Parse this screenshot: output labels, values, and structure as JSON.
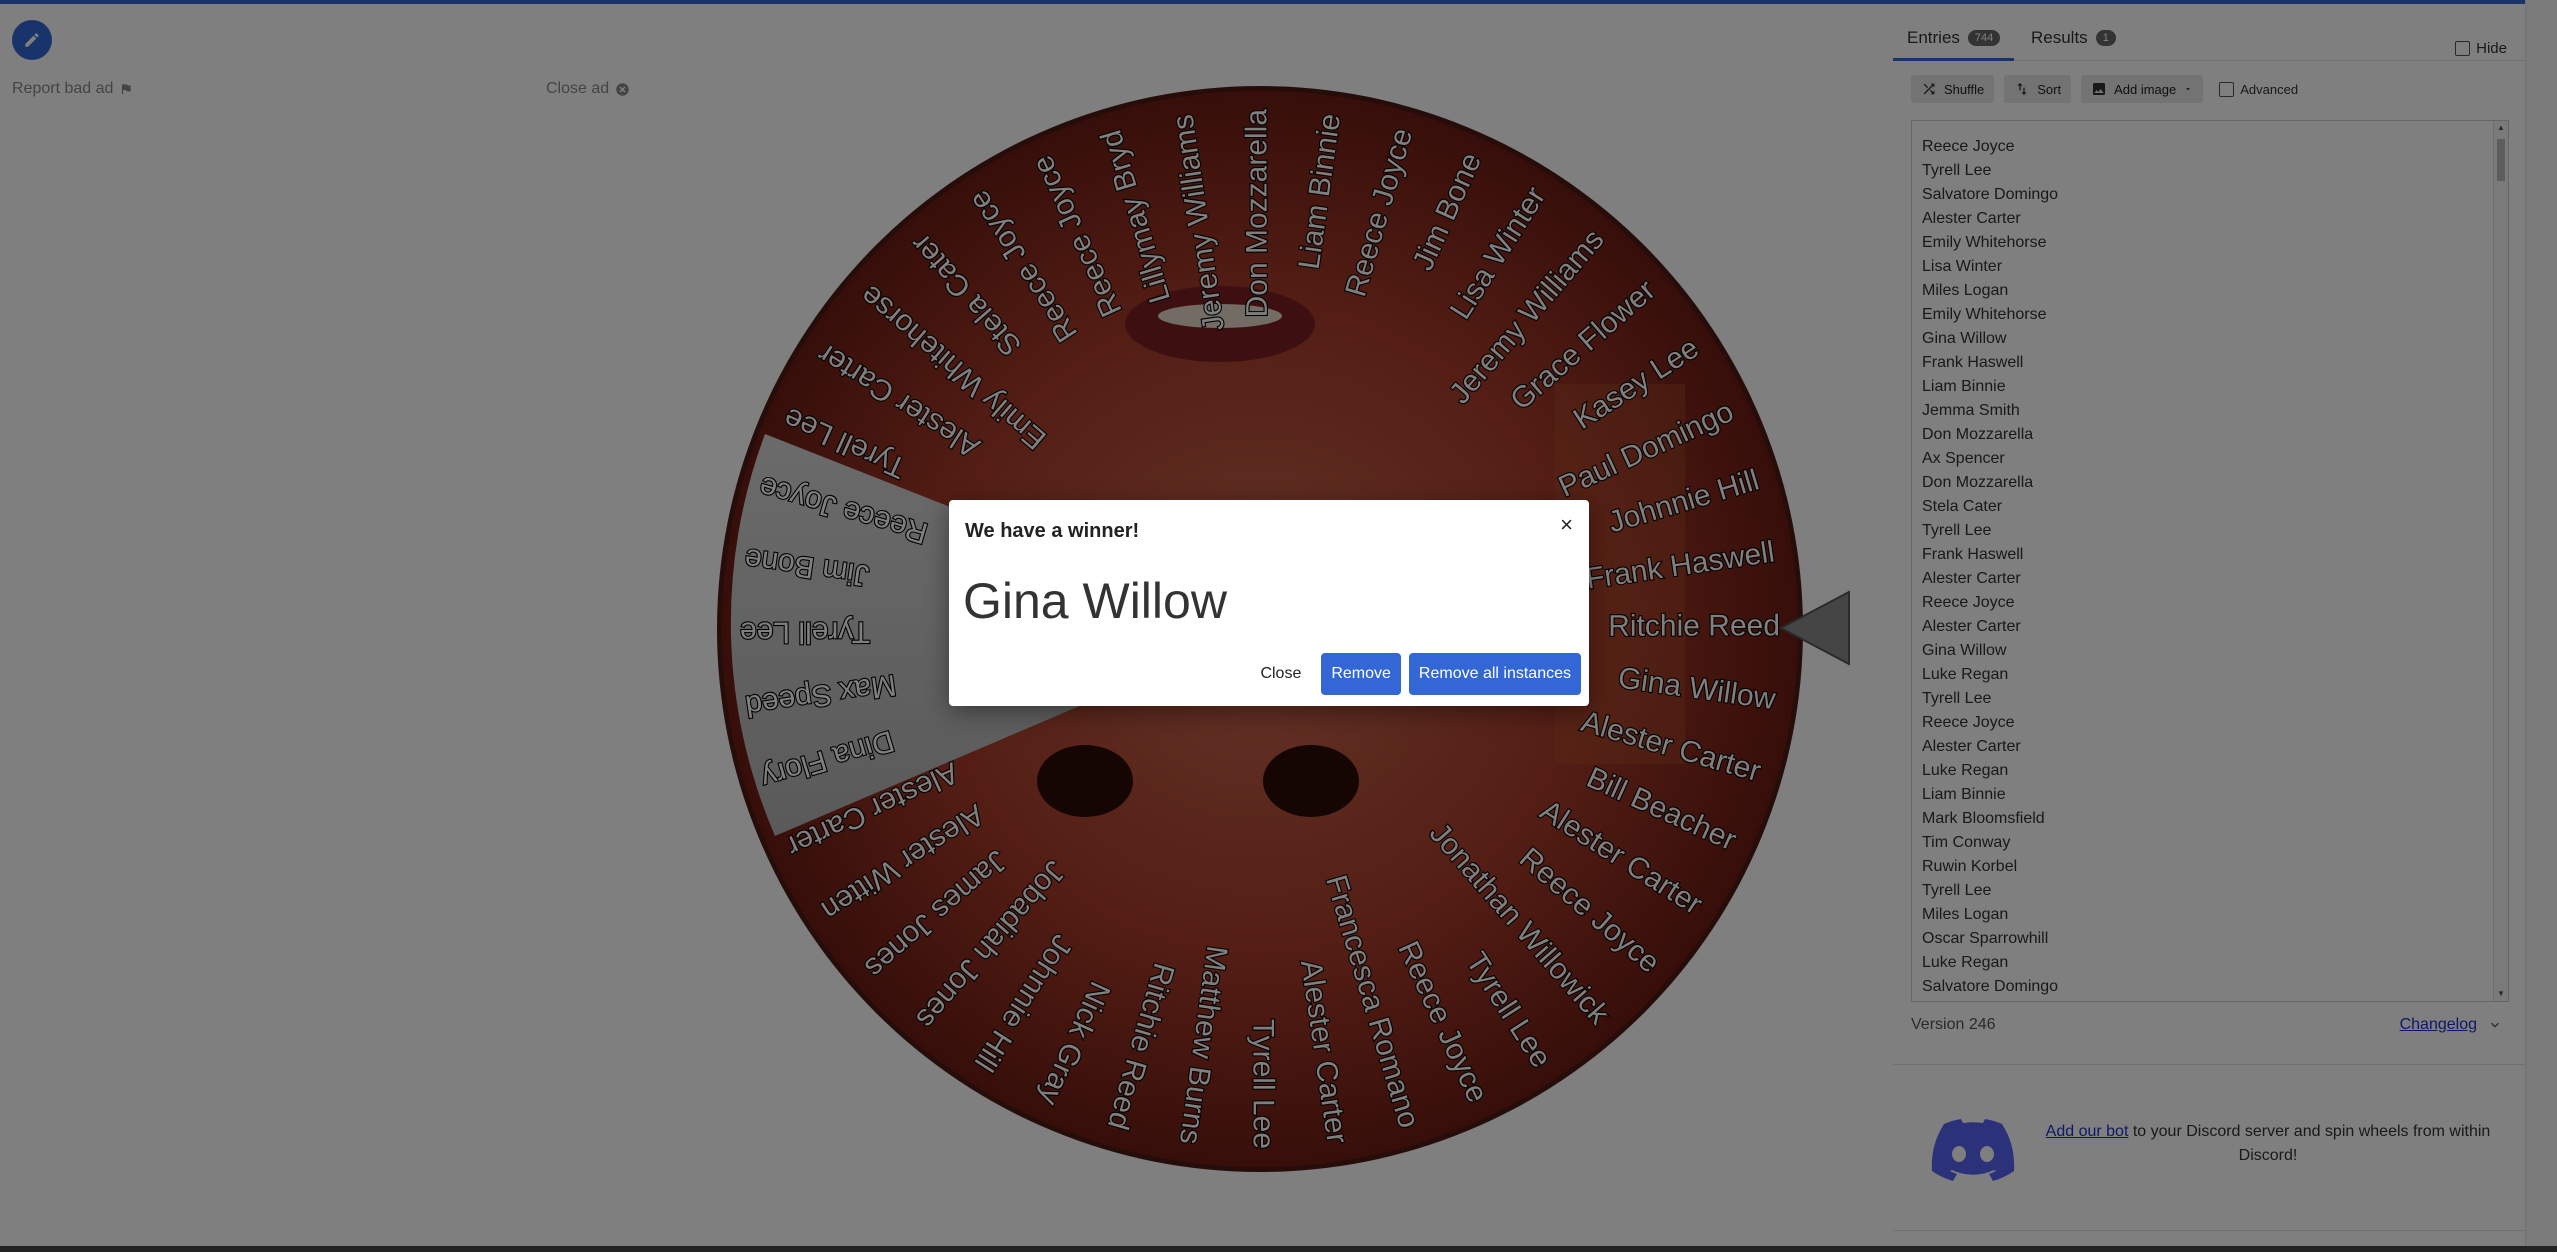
{
  "left_area": {
    "report_ad": "Report bad ad",
    "close_ad": "Close ad"
  },
  "wheel": {
    "names": [
      "Gina Willow",
      "Alester Carter",
      "Bill Beacher",
      "Alester Carter",
      "Reece Joyce",
      "Jonathan Willowick",
      "Tyrell Lee",
      "Reece Joyce",
      "Francesca Romano",
      "Alester Carter",
      "Tyrell Lee",
      "Matthew Burns",
      "Ritchie Reed",
      "Nick Gray",
      "Johnnie Hill",
      "Jobadiah Jones",
      "James Jones",
      "Alester Witten",
      "Alester Carter",
      "Dina Flory",
      "Max Speed",
      "Tyrell Lee",
      "Jim Bone",
      "Reece Joyce",
      "Tyrell Lee",
      "Alester Carter",
      "Emily Whitehorse",
      "Stela Cater",
      "Reece Joyce",
      "Reece Joyce",
      "Lillymay Bryd",
      "Jeremy Williams",
      "Don Mozzarella",
      "Liam Binnie",
      "Reece Joyce",
      "Jim Bone",
      "Lisa Winter",
      "Jeremy Williams",
      "Grace Flower",
      "Kasey Lee",
      "Paul Domingo",
      "Johnnie Hill",
      "Frank Haswell",
      "Ritchie Reed"
    ]
  },
  "panel": {
    "tabs": {
      "entries_label": "Entries",
      "entries_count": "744",
      "results_label": "Results",
      "results_count": "1"
    },
    "hide_label": "Hide",
    "toolbar": {
      "shuffle": "Shuffle",
      "sort": "Sort",
      "add_image": "Add image",
      "advanced": "Advanced"
    },
    "entries": [
      "Reece Joyce",
      "Tyrell Lee",
      "Salvatore Domingo",
      "Alester Carter",
      "Emily Whitehorse",
      "Lisa Winter",
      "Miles Logan",
      "Emily Whitehorse",
      "Gina Willow",
      "Frank Haswell",
      "Liam Binnie",
      "Jemma Smith",
      "Don Mozzarella",
      "Ax Spencer",
      "Don Mozzarella",
      "Stela Cater",
      "Tyrell Lee",
      "Frank Haswell",
      "Alester Carter",
      "Reece Joyce",
      "Alester Carter",
      "Gina Willow",
      "Luke Regan",
      "Tyrell Lee",
      "Reece Joyce",
      "Alester Carter",
      "Luke Regan",
      "Liam Binnie",
      "Mark Bloomsfield",
      "Tim Conway",
      "Ruwin Korbel",
      "Tyrell Lee",
      "Miles Logan",
      "Oscar Sparrowhill",
      "Luke Regan",
      "Salvatore Domingo"
    ],
    "version": "Version 246",
    "changelog": "Changelog",
    "discord": {
      "link": "Add our bot",
      "text": " to your Discord server and spin wheels from within Discord!"
    }
  },
  "modal": {
    "title": "We have a winner!",
    "close_x": "×",
    "winner": "Gina Willow",
    "close_button": "Close",
    "remove_button": "Remove",
    "remove_all_button": "Remove all instances"
  },
  "colors": {
    "accent": "#3367d6",
    "wheel_base": "#9a2f22"
  }
}
